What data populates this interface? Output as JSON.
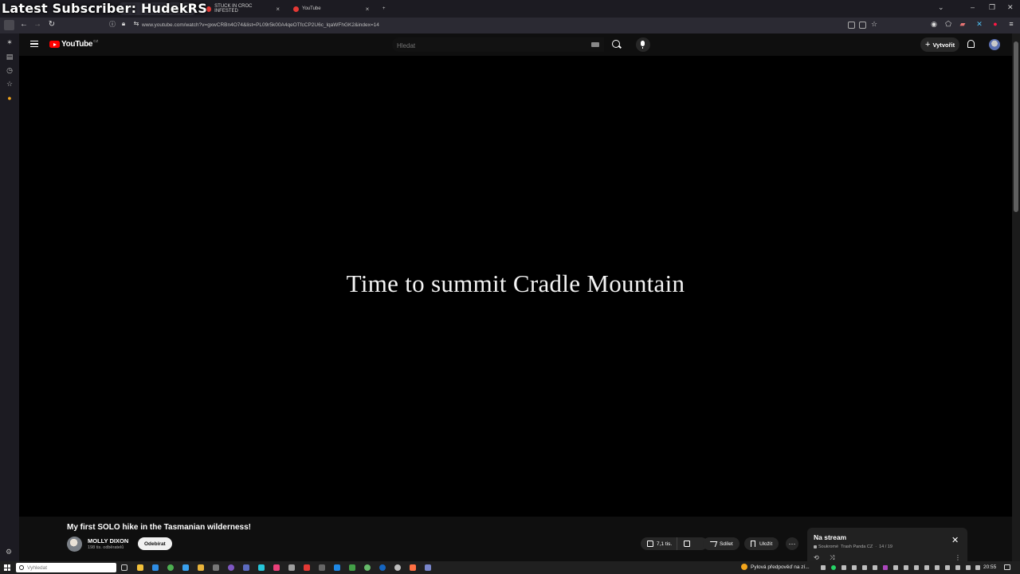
{
  "overlay": {
    "text": "Latest Subscriber: HudekRS"
  },
  "browser": {
    "tabs": [
      {
        "label": "STUCK IN CROC INFESTED"
      },
      {
        "label": "YouTube"
      }
    ],
    "new_tab": "+",
    "url": "www.youtube.com/watch?v=gxwCRBn4O74&list=PL09r5k00A4qeOTfcCP2U6c_lqaWFhGK2&index=14"
  },
  "youtube": {
    "logo_text": "YouTube",
    "logo_country": "CZ",
    "search_placeholder": "Hledat",
    "create_label": "Vytvořit",
    "video": {
      "overlay_text": "Time to summit Cradle Mountain",
      "title": "My first SOLO hike in the Tasmanian wilderness!",
      "channel_name": "MOLLY DIXON",
      "subscribers": "198 tis. odběratelů",
      "subscribe_label": "Odebírat",
      "likes": "7,1 tis.",
      "share_label": "Sdílet",
      "save_label": "Uložit",
      "more_label": "···"
    },
    "playlist": {
      "title": "Na stream",
      "privacy": "Soukromé",
      "owner": "Trash Panda CZ",
      "position": "14 / 19"
    }
  },
  "taskbar": {
    "search_placeholder": "Vyhledat",
    "weather_text": "Pylová předpověď na zí...",
    "clock": "20:55"
  },
  "colors": {
    "youtube_red": "#ff0000",
    "page_bg": "#0f0f0f",
    "player_bg": "#000000",
    "pill_bg": "#272727"
  }
}
